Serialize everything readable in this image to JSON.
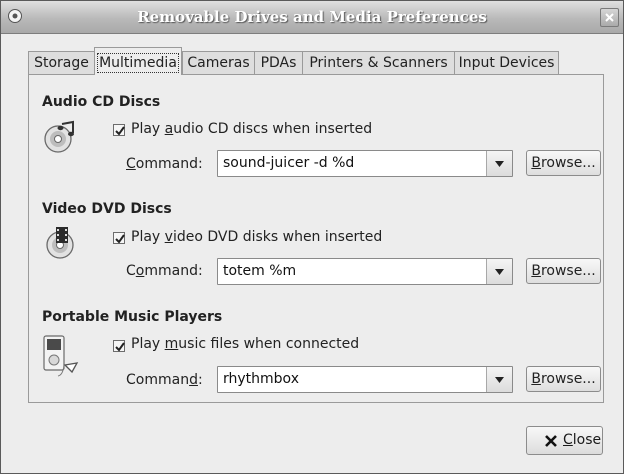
{
  "window": {
    "title": "Removable Drives and Media Preferences"
  },
  "tabs": [
    {
      "label": "Storage",
      "active": false
    },
    {
      "label": "Multimedia",
      "active": true
    },
    {
      "label": "Cameras",
      "active": false
    },
    {
      "label": "PDAs",
      "active": false
    },
    {
      "label": "Printers & Scanners",
      "active": false
    },
    {
      "label": "Input Devices",
      "active": false
    }
  ],
  "sections": {
    "audio": {
      "title": "Audio CD Discs",
      "icon": "audio-cd-icon",
      "checkbox_checked": true,
      "checkbox_pre": "Play ",
      "checkbox_mnemonic": "a",
      "checkbox_post": "udio CD discs when inserted",
      "command_pre": "",
      "command_mnemonic": "C",
      "command_post": "ommand:",
      "command_value": "sound-juicer -d %d"
    },
    "video": {
      "title": "Video DVD Discs",
      "icon": "video-dvd-icon",
      "checkbox_checked": true,
      "checkbox_pre": "Play ",
      "checkbox_mnemonic": "v",
      "checkbox_post": "ideo DVD disks when inserted",
      "command_pre": "C",
      "command_mnemonic": "o",
      "command_post": "mmand:",
      "command_value": "totem %m"
    },
    "music": {
      "title": "Portable Music Players",
      "icon": "music-player-icon",
      "checkbox_checked": true,
      "checkbox_pre": "Play ",
      "checkbox_mnemonic": "m",
      "checkbox_post": "usic files when connected",
      "command_pre": "Comman",
      "command_mnemonic": "d",
      "command_post": ":",
      "command_value": "rhythmbox"
    }
  },
  "browse": {
    "mnemonic": "B",
    "rest": "rowse..."
  },
  "footer": {
    "close_mnemonic": "C",
    "close_rest": "lose"
  }
}
